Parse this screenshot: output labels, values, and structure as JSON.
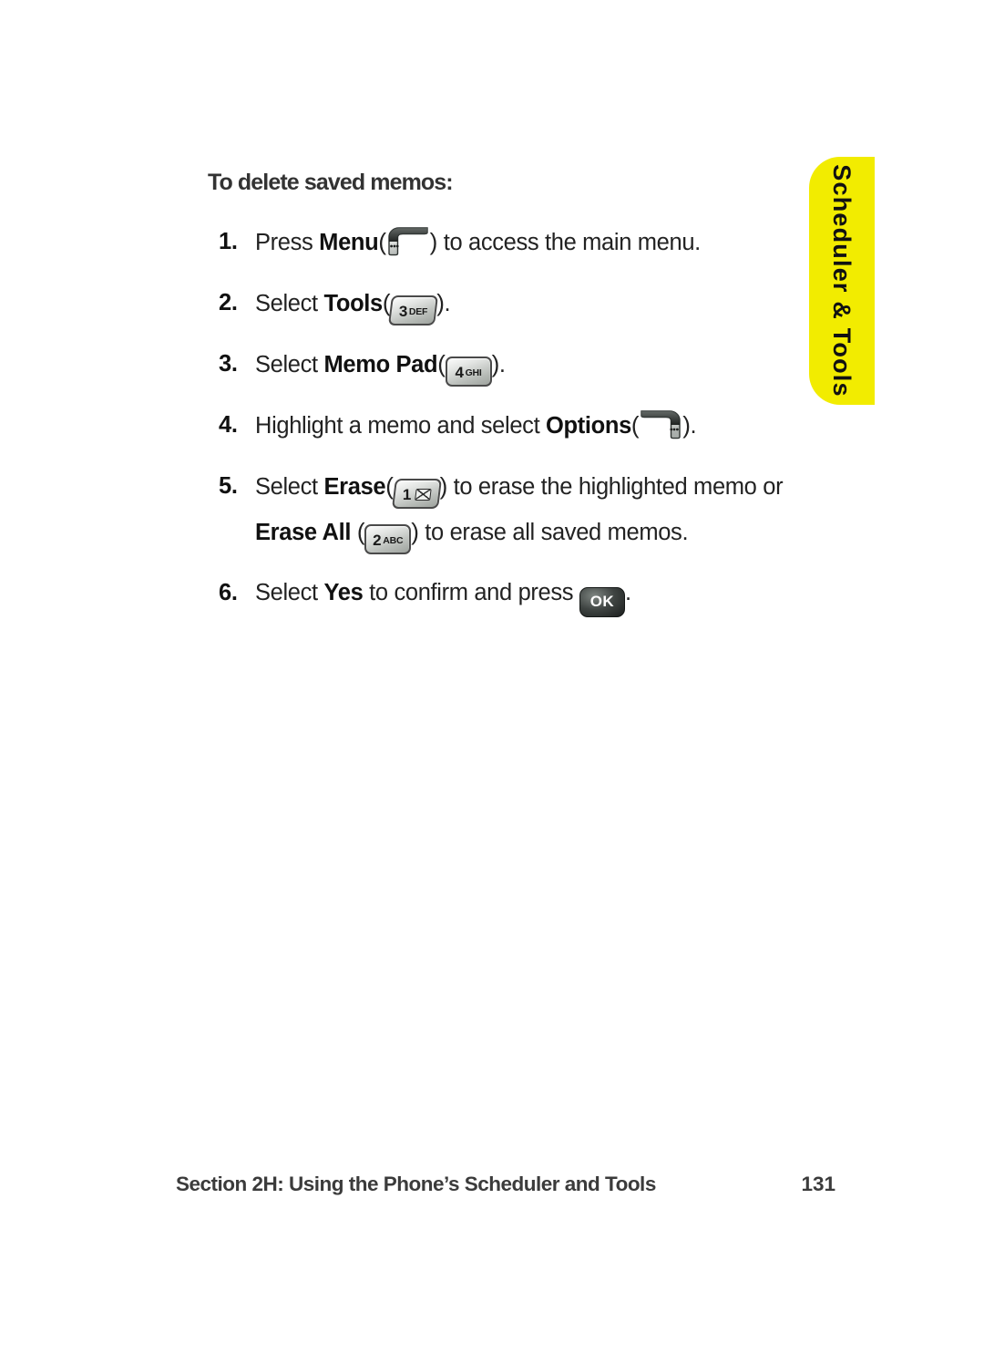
{
  "page": {
    "background_color": "#ffffff",
    "text_color": "#222222"
  },
  "side_tab": {
    "label": "Scheduler & Tools",
    "color": "#f2ec00",
    "text_color": "#111111",
    "orientation": "vertical-clockwise"
  },
  "content": {
    "heading": "To delete saved memos:",
    "steps": [
      {
        "number": "1.",
        "before": "Press ",
        "bold": "Menu",
        "paren_open": "(",
        "icon": "softkey-left-menu-icon",
        "paren_close": ")",
        "after": " to access the main menu."
      },
      {
        "number": "2.",
        "before": "Select ",
        "bold": "Tools",
        "paren_open": "(",
        "icon": "key-3-def-icon",
        "key_digit": "3",
        "key_letters": "DEF",
        "paren_close": ")",
        "after": "."
      },
      {
        "number": "3.",
        "before": "Select ",
        "bold": "Memo Pad",
        "paren_open": "(",
        "icon": "key-4-ghi-icon",
        "key_digit": "4",
        "key_letters": "GHI",
        "paren_close": ")",
        "after": "."
      },
      {
        "number": "4.",
        "before": "Highlight a memo and select ",
        "bold": "Options",
        "paren_open": "(",
        "icon": "softkey-right-options-icon",
        "paren_close": ")",
        "after": "."
      },
      {
        "number": "5.",
        "line1_before": "Select ",
        "line1_bold": "Erase",
        "line1_paren_open": "(",
        "line1_icon": "key-1-voicemail-icon",
        "line1_key_digit": "1",
        "line1_paren_close": ")",
        "line1_after": " to erase the highlighted memo or",
        "line2_bold": "Erase All",
        "line2_paren_open": " (",
        "line2_icon": "key-2-abc-icon",
        "line2_key_digit": "2",
        "line2_key_letters": "ABC",
        "line2_paren_close": ")",
        "line2_after": " to erase all saved memos."
      },
      {
        "number": "6.",
        "before": "Select ",
        "bold": "Yes",
        "mid": " to confirm and press ",
        "icon": "key-ok-icon",
        "key_label": "OK",
        "after": "."
      }
    ]
  },
  "footer": {
    "text": "Section 2H: Using the Phone’s Scheduler and Tools",
    "page_number": "131"
  }
}
